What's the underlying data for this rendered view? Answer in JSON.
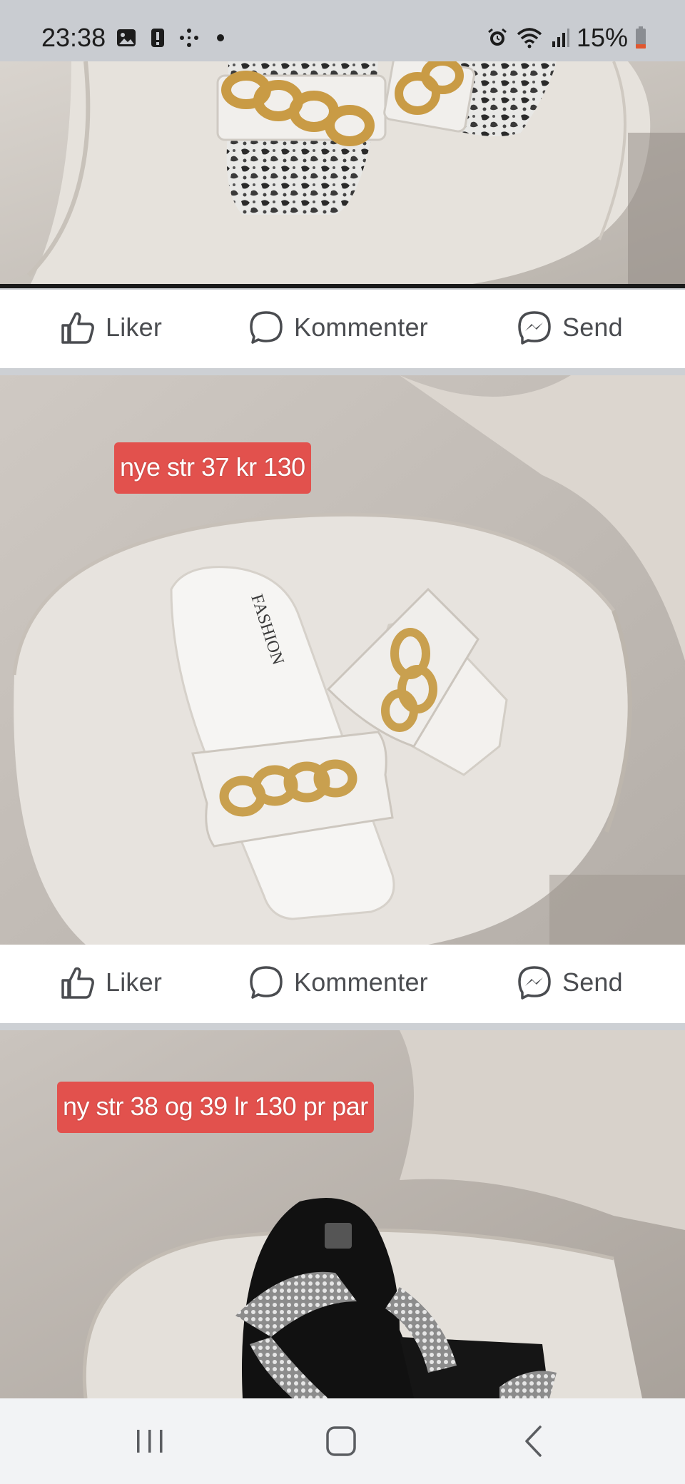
{
  "status_bar": {
    "time": "23:38",
    "battery": "15%",
    "left_icons": [
      "gallery-icon",
      "alert-icon",
      "dots-icon",
      "dot-icon"
    ],
    "right_icons": [
      "alarm-icon",
      "wifi-icon",
      "signal-icon",
      "battery-icon"
    ]
  },
  "posts": [
    {
      "actions": {
        "like": "Liker",
        "comment": "Kommenter",
        "send": "Send"
      }
    },
    {
      "price_label": "nye str 37 kr 130",
      "actions": {
        "like": "Liker",
        "comment": "Kommenter",
        "send": "Send"
      }
    },
    {
      "price_label": "ny str 38 og 39 lr 130 pr par"
    }
  ],
  "shoe_text": "FASHION",
  "colors": {
    "accent_red": "#e2514d",
    "icon_gray": "#4a4c50",
    "status_bg": "#c9ccd1"
  }
}
